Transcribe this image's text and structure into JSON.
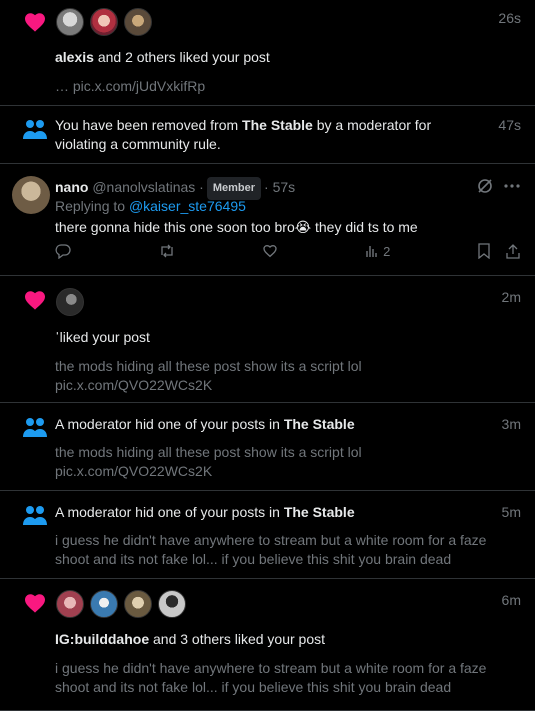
{
  "colors": {
    "heart": "#f91880",
    "accent": "#1d9bf0",
    "muted": "#71767b"
  },
  "items": [
    {
      "type": "like",
      "time": "26s",
      "actor": "alexis",
      "rest": " and 2 others liked your post",
      "snippet": "… pic.x.com/jUdVxkifRp"
    },
    {
      "type": "community",
      "time": "47s",
      "pre": "You have been removed from ",
      "community": "The Stable",
      "post": " by a moderator for violating a community rule."
    },
    {
      "type": "reply",
      "time": "57s",
      "name": "nano",
      "handle": "@nanolvslatinas",
      "badge": "Member",
      "replying_label": "Replying to ",
      "replying_to": "@kaiser_ste76495",
      "text_before": "there gonna hide this one soon too bro",
      "emoji": "😭",
      "text_after": " they did ts to me",
      "views": "2"
    },
    {
      "type": "like",
      "time": "2m",
      "actor": "ˈ",
      "rest": "liked your post",
      "snippet_lines": [
        "the mods hiding all these post show its a script lol",
        "pic.x.com/QVO22WCs2K"
      ]
    },
    {
      "type": "community",
      "time": "3m",
      "pre": "A moderator hid one of your posts in ",
      "community": "The Stable",
      "snippet_lines": [
        "the mods hiding all these post show its a script lol",
        "pic.x.com/QVO22WCs2K"
      ]
    },
    {
      "type": "community",
      "time": "5m",
      "pre": "A moderator hid one of your posts in ",
      "community": "The Stable",
      "snippet_lines": [
        "i guess he didn't have anywhere to stream but a white room for a faze",
        "shoot and its not fake lol... if you believe this shit you brain dead"
      ]
    },
    {
      "type": "like",
      "time": "6m",
      "actor": "IG:builddahoe",
      "rest": " and 3 others liked your post",
      "snippet_lines": [
        "i guess he didn't have anywhere to stream but a white room for a faze",
        "shoot and its not fake lol... if you believe this shit you brain dead"
      ]
    }
  ],
  "icons": [
    "heart-icon",
    "community-icon",
    "reply-icon",
    "retweet-icon",
    "like-icon",
    "views-icon",
    "bookmark-icon",
    "share-icon",
    "grok-icon",
    "more-icon"
  ]
}
